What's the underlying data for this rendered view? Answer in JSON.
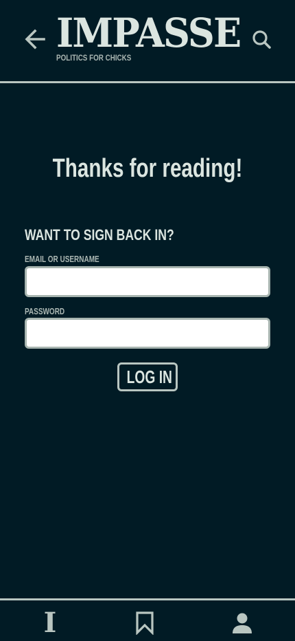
{
  "header": {
    "back_icon": "arrow-left-icon",
    "logo_text": "IMPASSE",
    "tagline": "POLITICS FOR CHICKS",
    "search_icon": "search-icon"
  },
  "main": {
    "title": "Thanks for reading!",
    "signin_heading": "WANT TO SIGN BACK IN?",
    "email_label": "EMAIL OR USERNAME",
    "email_value": "",
    "password_label": "PASSWORD",
    "password_value": "",
    "login_label": "LOG IN"
  },
  "bottom_nav": {
    "items": [
      {
        "icon": "impasse-logo-icon",
        "glyph": "I"
      },
      {
        "icon": "bookmark-icon"
      },
      {
        "icon": "account-icon"
      }
    ]
  },
  "colors": {
    "background": "#011b25",
    "text": "#dbe5e0",
    "muted": "#aab6b2",
    "rule": "#b9c6c1",
    "input_bg": "#ffffff"
  }
}
